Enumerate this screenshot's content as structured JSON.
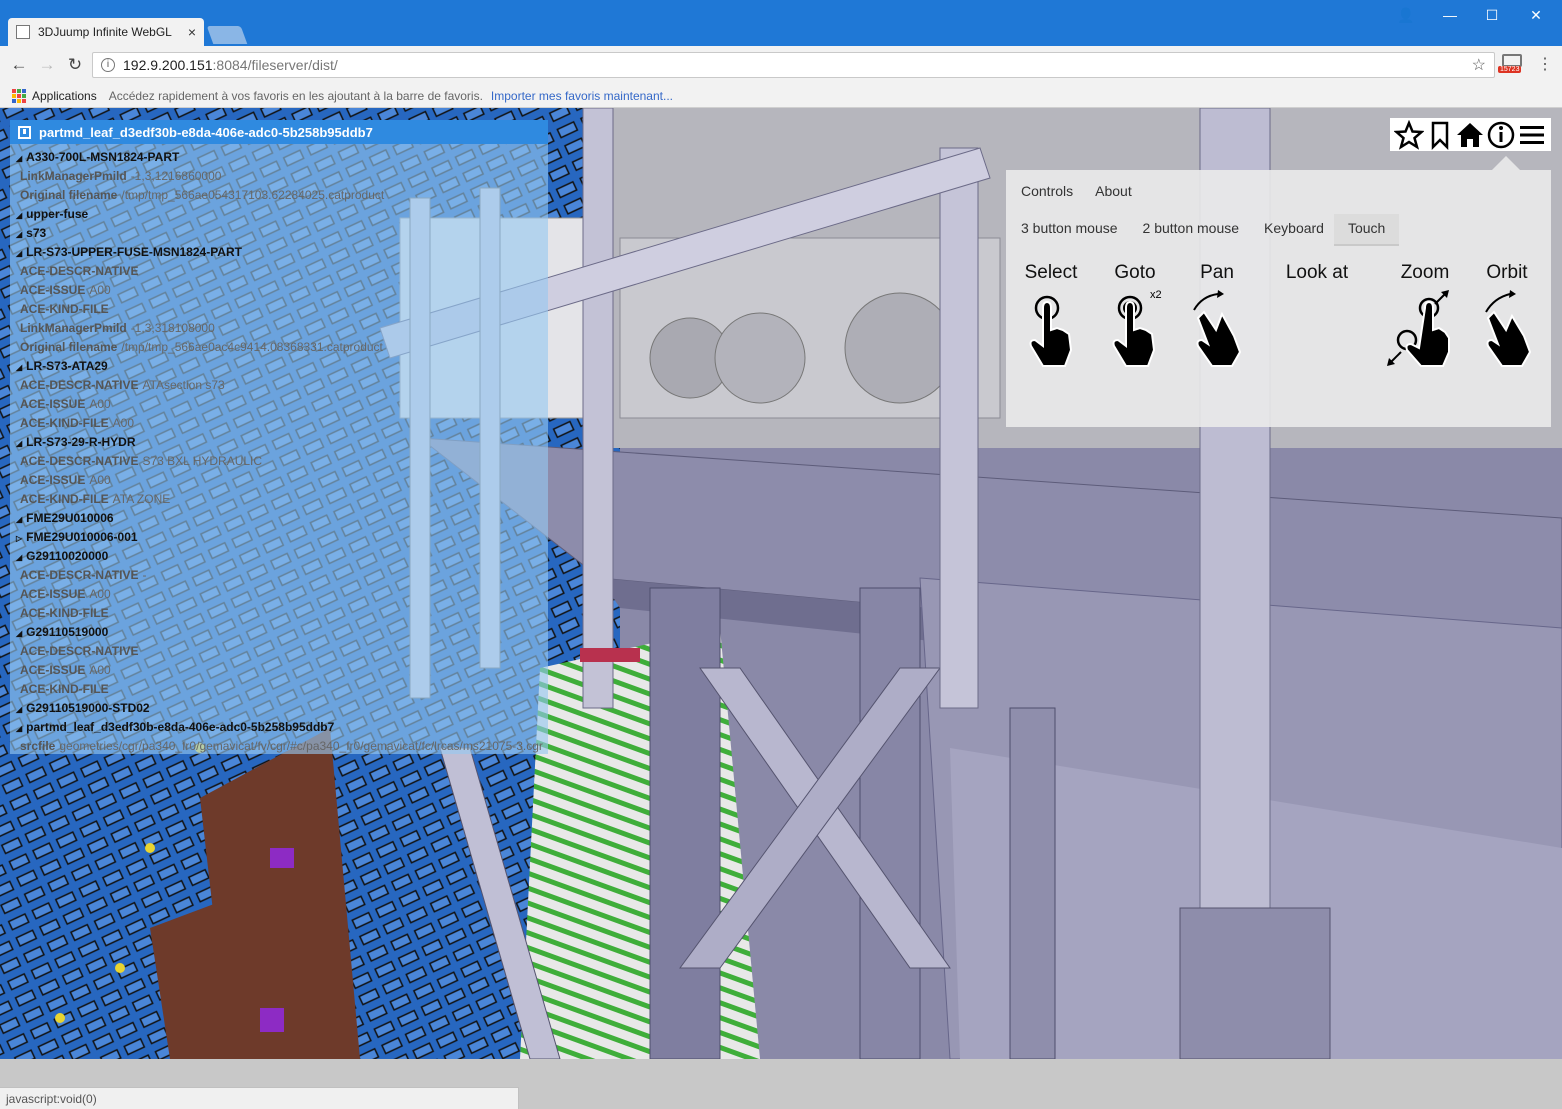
{
  "browser": {
    "tab_title": "3DJuump Infinite WebGL",
    "tab_close": "×",
    "window_controls": {
      "minimize": "—",
      "maximize": "☐",
      "close": "✕",
      "user": "👤"
    },
    "url_host": "192.9.200.151",
    "url_path": ":8084/fileserver/dist/",
    "extension_badge": "15723",
    "bookmarks": {
      "apps": "Applications",
      "hint": "Accédez rapidement à vos favoris en les ajoutant à la barre de favoris.",
      "import_link": "Importer mes favoris maintenant..."
    },
    "status_text": "javascript:void(0)"
  },
  "tree": {
    "header": "partmd_leaf_d3edf30b-e8da-406e-adc0-5b258b95ddb7",
    "rows": [
      {
        "type": "node",
        "label": "A330-700L-MSN1824-PART"
      },
      {
        "type": "attr",
        "key": "LinkManagerPmild",
        "value": "-1,3,1216860000"
      },
      {
        "type": "attr",
        "key": "Original filename",
        "value": "/tmp/tmp_566ae054317103.62284025.catproduct"
      },
      {
        "type": "node",
        "label": "upper-fuse"
      },
      {
        "type": "node",
        "label": "s73"
      },
      {
        "type": "node",
        "label": "LR-S73-UPPER-FUSE-MSN1824-PART"
      },
      {
        "type": "attr",
        "key": "ACE-DESCR-NATIVE",
        "value": ""
      },
      {
        "type": "attr",
        "key": "ACE-ISSUE",
        "value": "A00"
      },
      {
        "type": "attr",
        "key": "ACE-KIND-FILE",
        "value": ""
      },
      {
        "type": "attr",
        "key": "LinkManagerPmild",
        "value": "-1,3,318108000"
      },
      {
        "type": "attr",
        "key": "Original filename",
        "value": "/tmp/tmp_566ae0ac4c9414.08368331.catproduct"
      },
      {
        "type": "node",
        "label": "LR-S73-ATA29"
      },
      {
        "type": "attr",
        "key": "ACE-DESCR-NATIVE",
        "value": "ATAsection s73"
      },
      {
        "type": "attr",
        "key": "ACE-ISSUE",
        "value": "A00"
      },
      {
        "type": "attr",
        "key": "ACE-KIND-FILE",
        "value": "A00"
      },
      {
        "type": "node",
        "label": "LR-S73-29-R-HYDR"
      },
      {
        "type": "attr",
        "key": "ACE-DESCR-NATIVE",
        "value": "S73 BXL HYDRAULIC"
      },
      {
        "type": "attr",
        "key": "ACE-ISSUE",
        "value": "A00"
      },
      {
        "type": "attr",
        "key": "ACE-KIND-FILE",
        "value": "ATA ZONE"
      },
      {
        "type": "node",
        "label": "FME29U010006"
      },
      {
        "type": "node",
        "label": "FME29U010006-001",
        "collapsed": true
      },
      {
        "type": "node",
        "label": "G29110020000"
      },
      {
        "type": "attr",
        "key": "ACE-DESCR-NATIVE",
        "value": "-"
      },
      {
        "type": "attr",
        "key": "ACE-ISSUE",
        "value": "A00"
      },
      {
        "type": "attr",
        "key": "ACE-KIND-FILE",
        "value": ""
      },
      {
        "type": "node",
        "label": "G29110519000"
      },
      {
        "type": "attr",
        "key": "ACE-DESCR-NATIVE",
        "value": ""
      },
      {
        "type": "attr",
        "key": "ACE-ISSUE",
        "value": "A00"
      },
      {
        "type": "attr",
        "key": "ACE-KIND-FILE",
        "value": ""
      },
      {
        "type": "node",
        "label": "G29110519000-STD02"
      },
      {
        "type": "node",
        "label": "partmd_leaf_d3edf30b-e8da-406e-adc0-5b258b95ddb7"
      },
      {
        "type": "attr",
        "key": "srcfile",
        "value": "geometries/cgr/pa340_fr0/gemavicat/fv/cgr/#c/pa340_fr0/gemavicat/fc/lrcas/ms21075-3.cgr"
      }
    ]
  },
  "iconbar": [
    "star-icon",
    "bookmark-icon",
    "home-icon",
    "info-icon",
    "menu-icon"
  ],
  "controls": {
    "top_tabs": [
      "Controls",
      "About"
    ],
    "sub_tabs": [
      "3 button mouse",
      "2 button mouse",
      "Keyboard",
      "Touch"
    ],
    "active_sub_tab": "Touch",
    "gestures": [
      {
        "label": "Select",
        "icon": "tap-icon"
      },
      {
        "label": "Goto",
        "icon": "double-tap-icon",
        "badge": "x2"
      },
      {
        "label": "Pan",
        "icon": "two-finger-drag-icon"
      },
      {
        "label": "Look at",
        "icon": ""
      },
      {
        "label": "Zoom",
        "icon": "pinch-icon"
      },
      {
        "label": "Orbit",
        "icon": "rotate-icon"
      }
    ]
  },
  "colors": {
    "chrome_blue": "#1f78d6",
    "tree_header": "#2f8ae0",
    "model_purple": "#8a89a8",
    "fuselage_blue": "#2767c0"
  }
}
